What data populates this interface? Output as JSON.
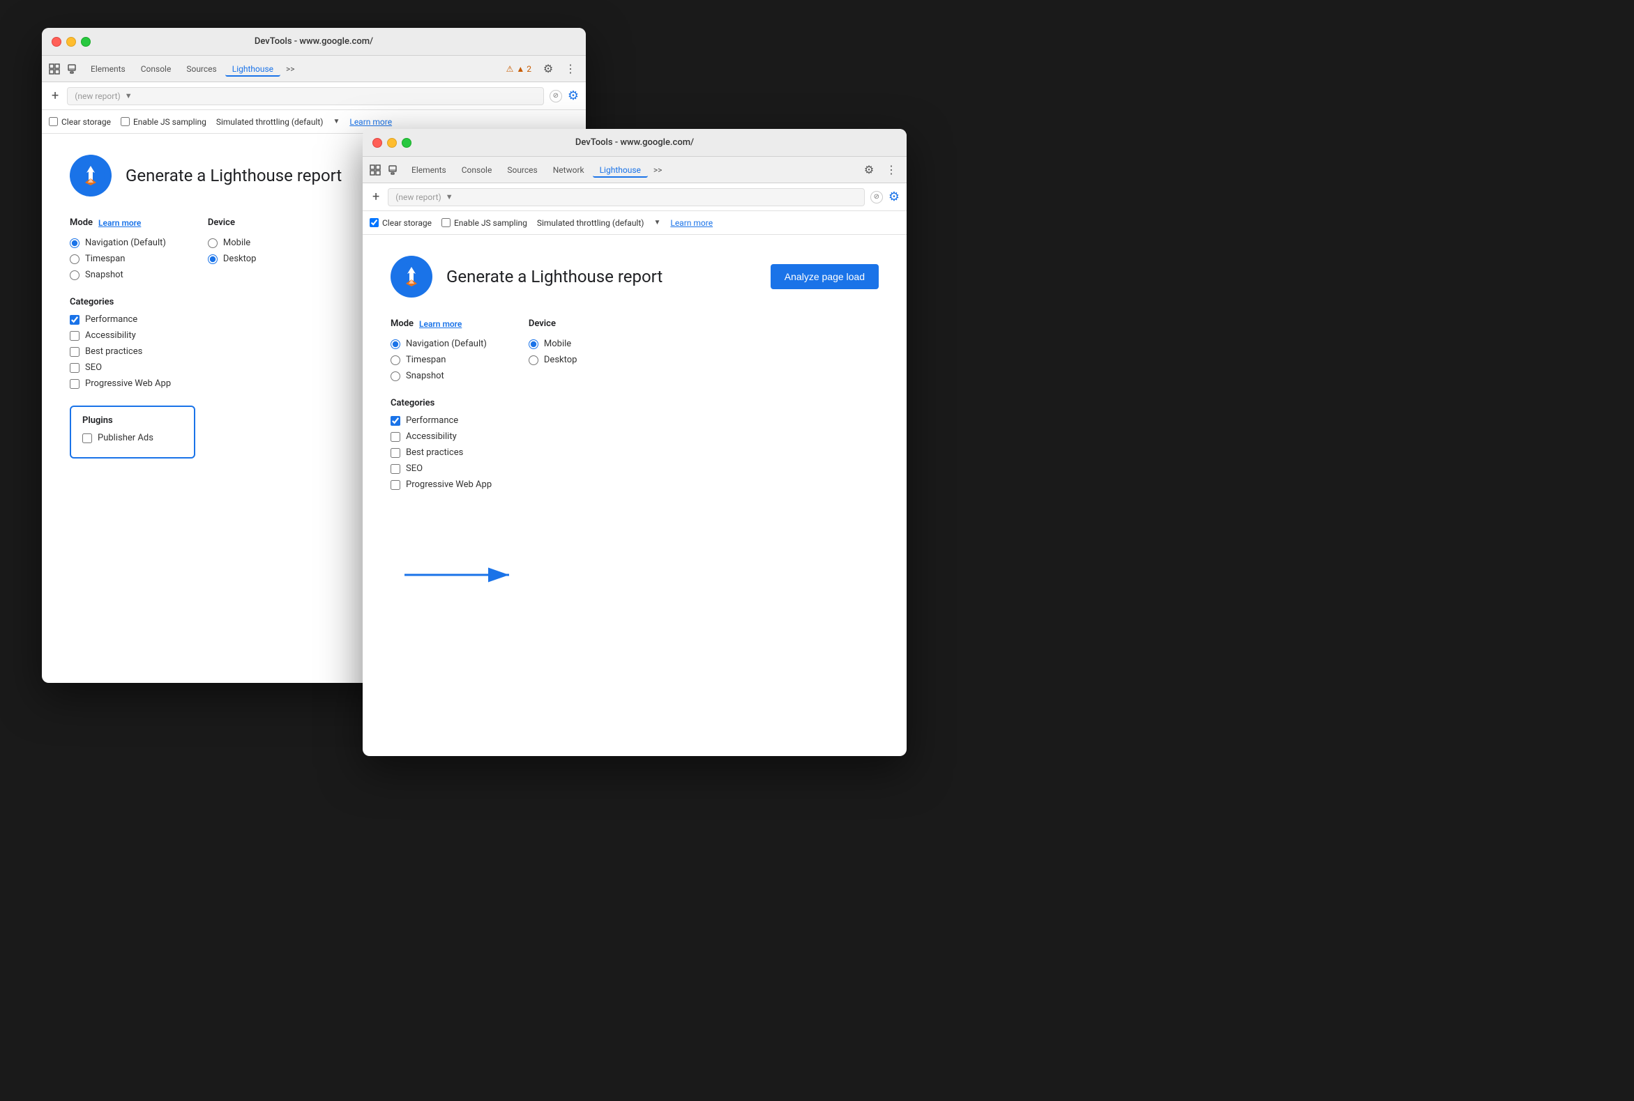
{
  "window1": {
    "title": "DevTools - www.google.com/",
    "tabs": [
      "Elements",
      "Console",
      "Sources",
      "Lighthouse",
      ">>"
    ],
    "active_tab": "Lighthouse",
    "warning": "▲ 2",
    "report_placeholder": "(new report)",
    "checkboxes": {
      "clear_storage": {
        "label": "Clear storage",
        "checked": false
      },
      "enable_js": {
        "label": "Enable JS sampling",
        "checked": false
      }
    },
    "throttling": "Simulated throttling (default)",
    "learn_more": "Learn more",
    "header": {
      "title": "Generate a Lighthouse report"
    },
    "mode": {
      "label": "Mode",
      "learn_more": "Learn more",
      "options": [
        {
          "label": "Navigation (Default)",
          "checked": true
        },
        {
          "label": "Timespan",
          "checked": false
        },
        {
          "label": "Snapshot",
          "checked": false
        }
      ]
    },
    "device": {
      "label": "Device",
      "options": [
        {
          "label": "Mobile",
          "checked": false
        },
        {
          "label": "Desktop",
          "checked": true
        }
      ]
    },
    "categories": {
      "label": "Categories",
      "items": [
        {
          "label": "Performance",
          "checked": true
        },
        {
          "label": "Accessibility",
          "checked": false
        },
        {
          "label": "Best practices",
          "checked": false
        },
        {
          "label": "SEO",
          "checked": false
        },
        {
          "label": "Progressive Web App",
          "checked": false
        }
      ]
    },
    "plugins": {
      "label": "Plugins",
      "items": [
        {
          "label": "Publisher Ads",
          "checked": false
        }
      ]
    }
  },
  "window2": {
    "title": "DevTools - www.google.com/",
    "tabs": [
      "Elements",
      "Console",
      "Sources",
      "Network",
      "Lighthouse",
      ">>"
    ],
    "active_tab": "Lighthouse",
    "report_placeholder": "(new report)",
    "checkboxes": {
      "clear_storage": {
        "label": "Clear storage",
        "checked": true
      },
      "enable_js": {
        "label": "Enable JS sampling",
        "checked": false
      }
    },
    "throttling": "Simulated throttling (default)",
    "learn_more": "Learn more",
    "header": {
      "title": "Generate a Lighthouse report",
      "analyze_btn": "Analyze page load"
    },
    "mode": {
      "label": "Mode",
      "learn_more": "Learn more",
      "options": [
        {
          "label": "Navigation (Default)",
          "checked": true
        },
        {
          "label": "Timespan",
          "checked": false
        },
        {
          "label": "Snapshot",
          "checked": false
        }
      ]
    },
    "device": {
      "label": "Device",
      "options": [
        {
          "label": "Mobile",
          "checked": true
        },
        {
          "label": "Desktop",
          "checked": false
        }
      ]
    },
    "categories": {
      "label": "Categories",
      "items": [
        {
          "label": "Performance",
          "checked": true
        },
        {
          "label": "Accessibility",
          "checked": false
        },
        {
          "label": "Best practices",
          "checked": false
        },
        {
          "label": "SEO",
          "checked": false
        },
        {
          "label": "Progressive Web App",
          "checked": false
        }
      ]
    }
  }
}
